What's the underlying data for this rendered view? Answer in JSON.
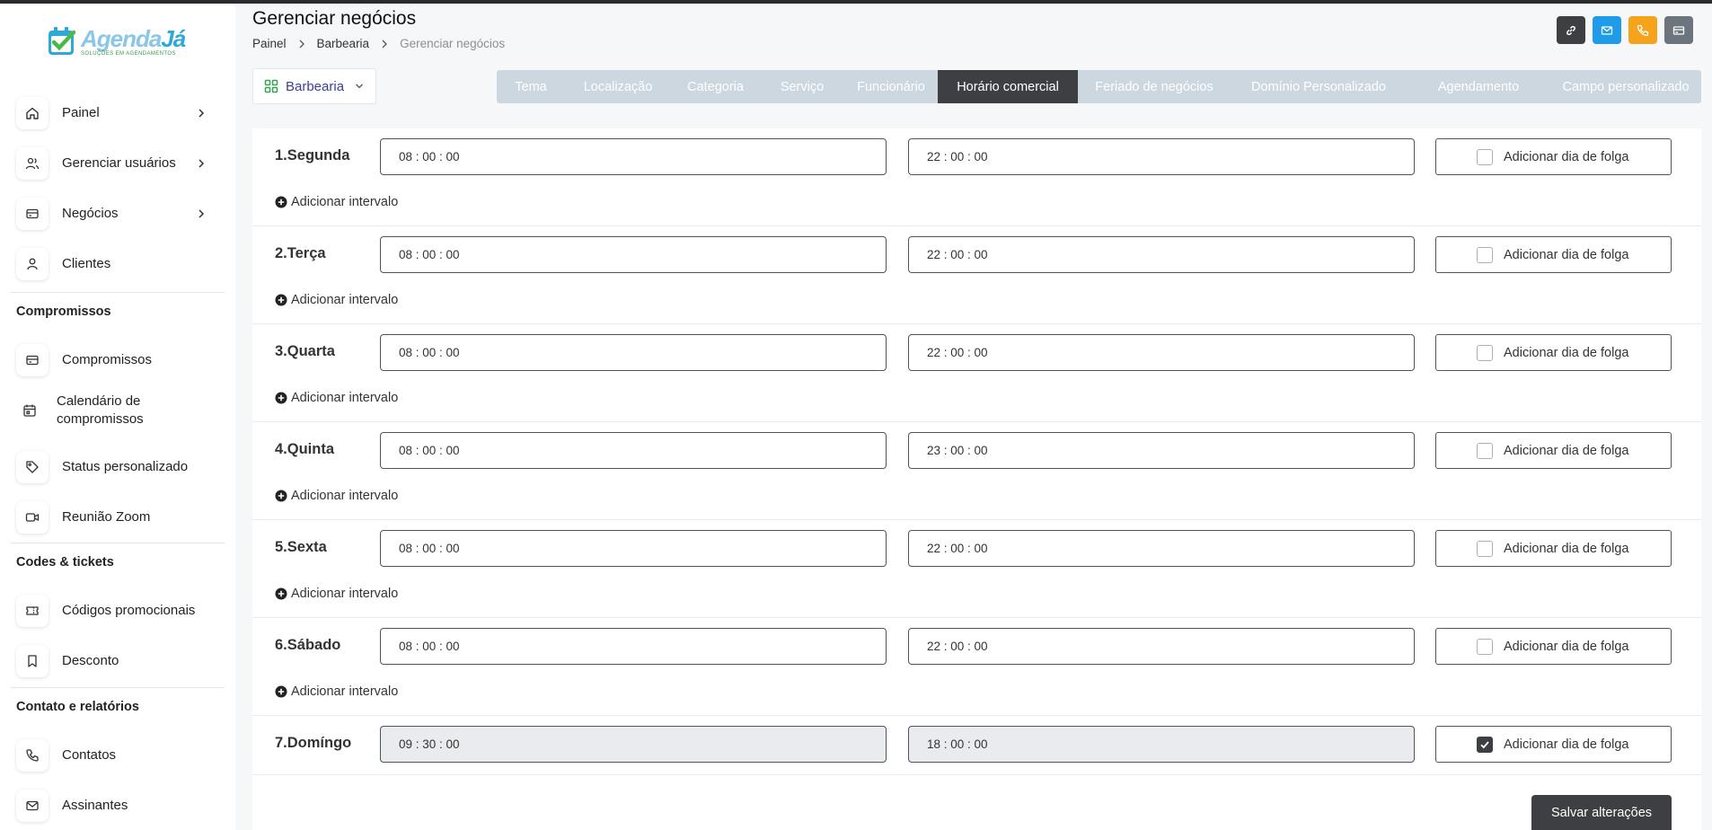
{
  "logo": {
    "text_a": "Agenda",
    "text_b": "Já",
    "tagline": "SOLUÇÕES EM AGENDAMENTOS"
  },
  "sidebar": {
    "items": [
      {
        "label": "Painel",
        "icon": "home-icon"
      },
      {
        "label": "Gerenciar usuários",
        "icon": "users-icon"
      },
      {
        "label": "Negócios",
        "icon": "card-icon"
      },
      {
        "label": "Clientes",
        "icon": "user-icon"
      }
    ],
    "sections": [
      {
        "title": "Compromissos",
        "items": [
          {
            "label": "Compromissos",
            "icon": "card-icon"
          },
          {
            "label": "Calendário de compromissos",
            "icon": "calendar-icon"
          },
          {
            "label": "Status personalizado",
            "icon": "tag-icon"
          },
          {
            "label": "Reunião Zoom",
            "icon": "video-icon"
          }
        ]
      },
      {
        "title": "Codes & tickets",
        "items": [
          {
            "label": "Códigos promocionais",
            "icon": "ticket-icon"
          },
          {
            "label": "Desconto",
            "icon": "bookmark-icon"
          }
        ]
      },
      {
        "title": "Contato e relatórios",
        "items": [
          {
            "label": "Contatos",
            "icon": "phone-icon"
          },
          {
            "label": "Assinantes",
            "icon": "mail-icon"
          }
        ]
      }
    ]
  },
  "header": {
    "title": "Gerenciar negócios",
    "breadcrumb": [
      "Painel",
      "Barbearia",
      "Gerenciar negócios"
    ],
    "buttons": [
      {
        "icon": "link-icon",
        "color": "#3d3f42"
      },
      {
        "icon": "mail-icon",
        "color": "#1e9be9"
      },
      {
        "icon": "phone-icon",
        "color": "#f5a31a"
      },
      {
        "icon": "card-icon",
        "color": "#6c757d"
      }
    ]
  },
  "business_select": {
    "value": "Barbearia"
  },
  "tabs": [
    {
      "label": "Tema"
    },
    {
      "label": "Localização"
    },
    {
      "label": "Categoria"
    },
    {
      "label": "Serviço"
    },
    {
      "label": "Funcionário"
    },
    {
      "label": "Horário comercial",
      "active": true
    },
    {
      "label": "Feriado de negócios"
    },
    {
      "label": "Domínio Personalizado"
    },
    {
      "label": "Agendamento"
    },
    {
      "label": "Campo personalizado"
    }
  ],
  "schedule": {
    "dayoff_label": "Adicionar dia de folga",
    "add_interval_label": "Adicionar intervalo",
    "days": [
      {
        "label": "1.Segunda",
        "start": "08 : 00 : 00",
        "end": "22 : 00 : 00",
        "day_off": false
      },
      {
        "label": "2.Terça",
        "start": "08 : 00 : 00",
        "end": "22 : 00 : 00",
        "day_off": false
      },
      {
        "label": "3.Quarta",
        "start": "08 : 00 : 00",
        "end": "22 : 00 : 00",
        "day_off": false
      },
      {
        "label": "4.Quinta",
        "start": "08 : 00 : 00",
        "end": "23 : 00 : 00",
        "day_off": false
      },
      {
        "label": "5.Sexta",
        "start": "08 : 00 : 00",
        "end": "22 : 00 : 00",
        "day_off": false
      },
      {
        "label": "6.Sábado",
        "start": "08 : 00 : 00",
        "end": "22 : 00 : 00",
        "day_off": false
      },
      {
        "label": "7.Domíngo",
        "start": "09 : 30 : 00",
        "end": "18 : 00 : 00",
        "day_off": true
      }
    ]
  },
  "save_label": "Salvar alterações"
}
